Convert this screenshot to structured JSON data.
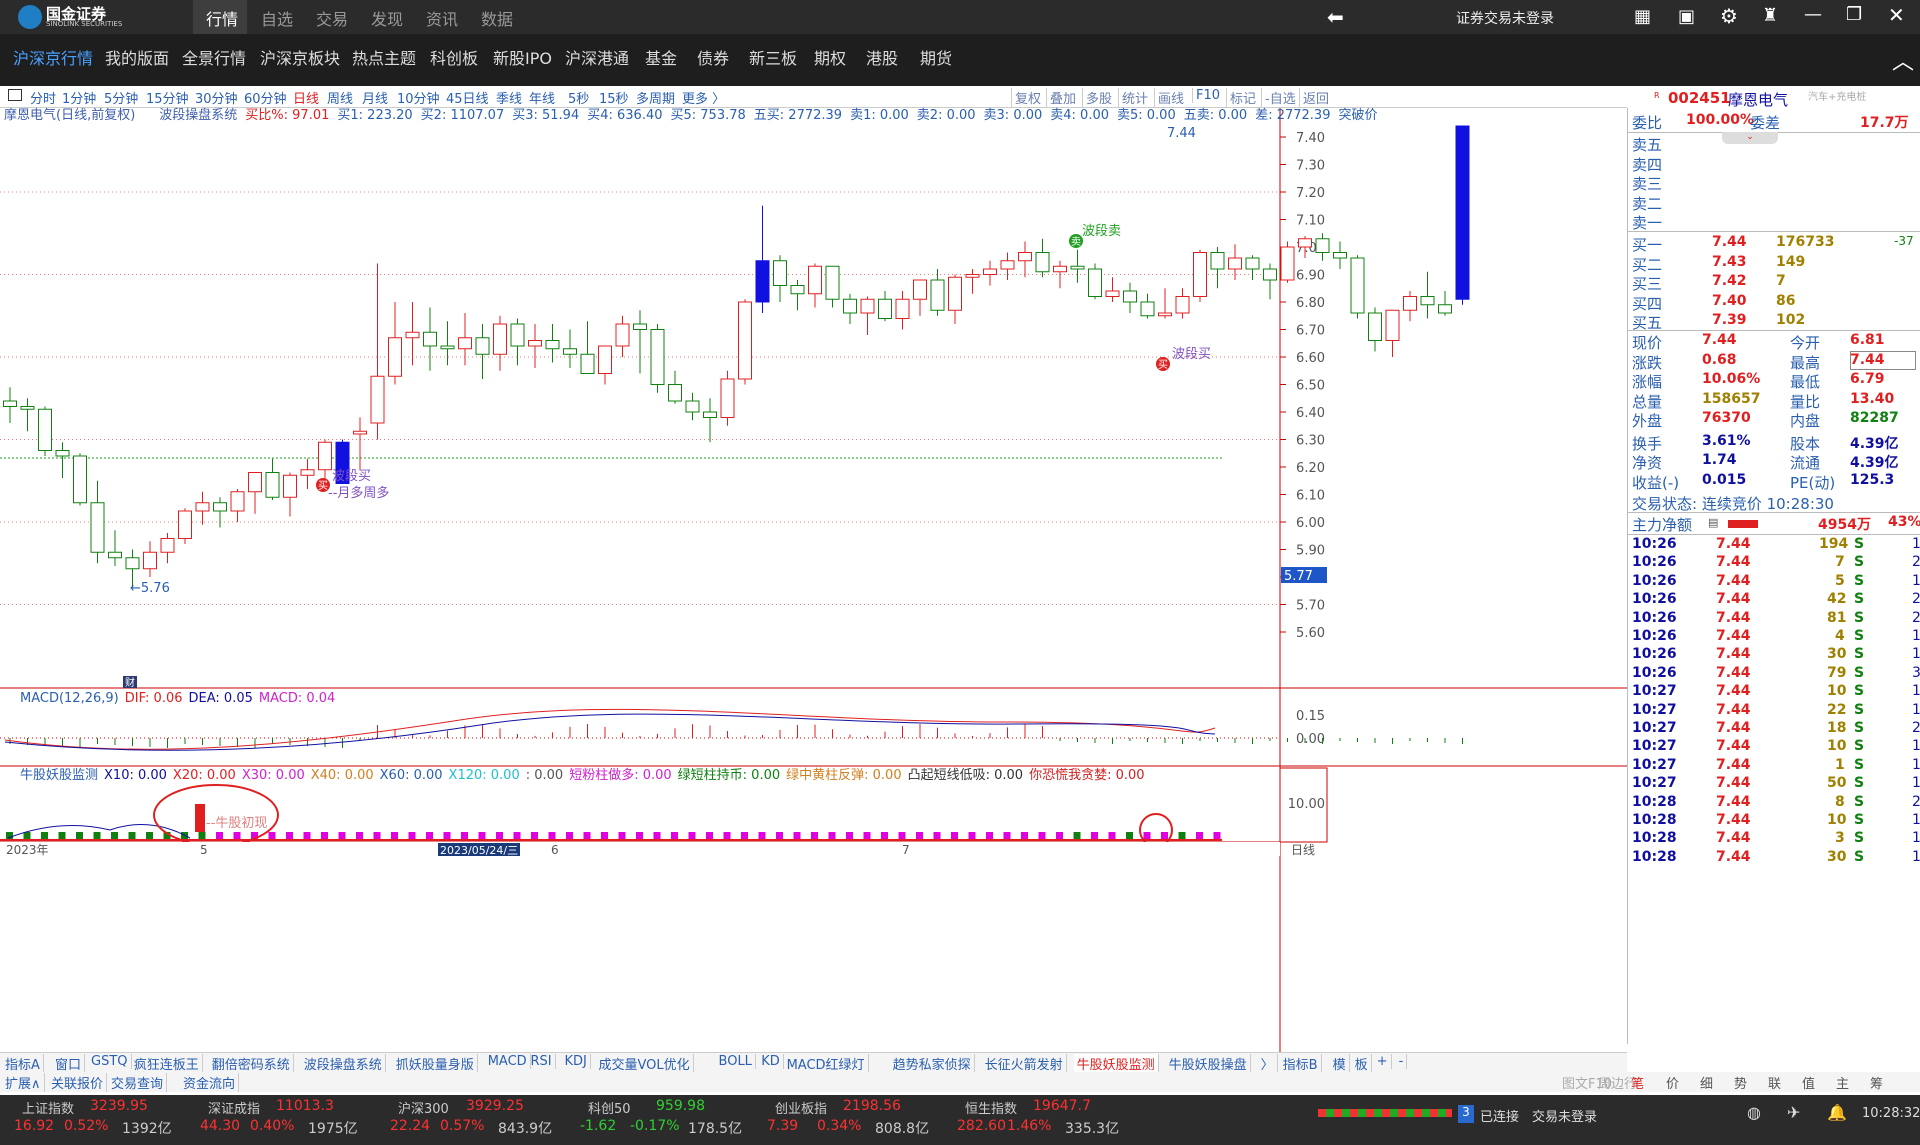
{
  "app": {
    "logo_text": "国金证券",
    "logo_sub": "SINOLINK SECURITIES",
    "login_status": "证券交易未登录"
  },
  "top_tabs": [
    "行情",
    "自选",
    "交易",
    "发现",
    "资讯",
    "数据"
  ],
  "nav_tabs": [
    "沪深京行情",
    "我的版面",
    "全景行情",
    "沪深京板块",
    "热点主题",
    "科创板",
    "新股IPO",
    "沪深港通",
    "基金",
    "债券",
    "新三板",
    "期权",
    "港股",
    "期货"
  ],
  "periods": [
    "分时",
    "1分钟",
    "5分钟",
    "15分钟",
    "30分钟",
    "60分钟",
    "日线",
    "周线",
    "月线",
    "10分钟",
    "45日线",
    "季线",
    "年线",
    "5秒",
    "15秒",
    "多周期",
    "更多 〉"
  ],
  "chart_tools": [
    "复权",
    "叠加",
    "多股",
    "统计",
    "画线",
    "F10",
    "标记",
    "-自选",
    "返回"
  ],
  "info_line": {
    "stock": "摩恩电气(日线,前复权)",
    "system": "波段操盘系统",
    "items": [
      "买比%: 97.01",
      "买1: 223.20",
      "买2: 1107.07",
      "买3: 51.94",
      "买4: 636.40",
      "买5: 753.78",
      "五买: 2772.39",
      "卖1: 0.00",
      "卖2: 0.00",
      "卖3: 0.00",
      "卖4: 0.00",
      "卖5: 0.00",
      "五卖: 0.00",
      "差: 2772.39",
      "突破价"
    ]
  },
  "price_labels": [
    "7.40",
    "7.30",
    "7.20",
    "7.10",
    "7.00",
    "6.90",
    "6.80",
    "6.70",
    "6.60",
    "6.50",
    "6.40",
    "6.30",
    "6.20",
    "6.10",
    "6.00",
    "5.90",
    "5.80",
    "5.70",
    "5.60"
  ],
  "current_tag": "5.77",
  "annotations": {
    "low": "←5.76",
    "high": "7.44",
    "buy1": "波段买",
    "buy1b": "--月多周多",
    "sell": "波段卖",
    "buy2": "波段买",
    "buy_mark": "买",
    "sell_mark": "卖",
    "fin": "财"
  },
  "date_axis": {
    "year": "2023年",
    "m5": "5",
    "m6": "6",
    "m7": "7",
    "cursor": "2023/05/24/三",
    "period": "日线"
  },
  "macd": {
    "title": "MACD(12,26,9)",
    "dif": "DIF: 0.06",
    "dea": "DEA: 0.05",
    "macd": "MACD: 0.04",
    "labels": [
      "0.15",
      "0.00"
    ]
  },
  "monitor": {
    "title": "牛股妖股监测",
    "items": [
      "X10: 0.00",
      "X20: 0.00",
      "X30: 0.00",
      "X40: 0.00",
      "X60: 0.00",
      "X120: 0.00",
      ": 0.00",
      "短粉柱做多: 0.00",
      "绿短柱持币: 0.00",
      "绿中黄柱反弹: 0.00",
      "凸起短线低吸: 0.00",
      "你恐慌我贪婪: 0.00"
    ],
    "label": "10.00",
    "callout": "--牛股初现"
  },
  "bottom_tabs": [
    "指标A",
    "窗口",
    "GSTQ",
    "疯狂连板王",
    "翻倍密码系统",
    "波段操盘系统",
    "抓妖股量身版",
    "MACD",
    "RSI",
    "KDJ",
    "成交量VOL优化",
    "BOLL",
    "KD",
    "MACD红绿灯",
    "趋势私家侦探",
    "长征火箭发射",
    "牛股妖股监测",
    "牛股妖股操盘",
    "〉",
    "指标B",
    "模",
    "板",
    "+",
    "-"
  ],
  "bottom_tabs2": [
    "扩展∧",
    "关联报价",
    "交易查询",
    "资金流向"
  ],
  "right_bottom_tabs": [
    "图文F10",
    "周边行",
    "笔",
    "价",
    "细",
    "势",
    "联",
    "值",
    "主",
    "筹"
  ],
  "quote": {
    "code": "002451",
    "name": "摩恩电气",
    "tag": "汽车+充电桩",
    "weibi": "委比",
    "weibi_val": "100.00%",
    "weicha": "委差",
    "weicha_val": "17.7万",
    "sells": [
      "卖五",
      "卖四",
      "卖三",
      "卖二",
      "卖一"
    ],
    "buys": [
      [
        "买一",
        "7.44",
        "176733",
        "-37"
      ],
      [
        "买二",
        "7.43",
        "149",
        ""
      ],
      [
        "买三",
        "7.42",
        "7",
        ""
      ],
      [
        "买四",
        "7.40",
        "86",
        ""
      ],
      [
        "买五",
        "7.39",
        "102",
        ""
      ]
    ],
    "stats": [
      [
        "现价",
        "7.44",
        "今开",
        "6.81"
      ],
      [
        "涨跌",
        "0.68",
        "最高",
        "7.44"
      ],
      [
        "涨幅",
        "10.06%",
        "最低",
        "6.79"
      ],
      [
        "总量",
        "158657",
        "量比",
        "13.40"
      ],
      [
        "外盘",
        "76370",
        "内盘",
        "82287"
      ],
      [
        "换手",
        "3.61%",
        "股本",
        "4.39亿"
      ],
      [
        "净资",
        "1.74",
        "流通",
        "4.39亿"
      ],
      [
        "收益(-)",
        "0.015",
        "PE(动)",
        "125.3"
      ]
    ],
    "trade_status": "交易状态: 连续竞价 10:28:30",
    "main_flow": "主力净额",
    "main_flow_val": "4954万",
    "main_flow_pct": "43%",
    "ticks": [
      [
        "10:26",
        "7.44",
        "194",
        "S",
        "1"
      ],
      [
        "10:26",
        "7.44",
        "7",
        "S",
        "2"
      ],
      [
        "10:26",
        "7.44",
        "5",
        "S",
        "1"
      ],
      [
        "10:26",
        "7.44",
        "42",
        "S",
        "2"
      ],
      [
        "10:26",
        "7.44",
        "81",
        "S",
        "2"
      ],
      [
        "10:26",
        "7.44",
        "4",
        "S",
        "1"
      ],
      [
        "10:26",
        "7.44",
        "30",
        "S",
        "1"
      ],
      [
        "10:26",
        "7.44",
        "79",
        "S",
        "3"
      ],
      [
        "10:27",
        "7.44",
        "10",
        "S",
        "1"
      ],
      [
        "10:27",
        "7.44",
        "22",
        "S",
        "1"
      ],
      [
        "10:27",
        "7.44",
        "18",
        "S",
        "2"
      ],
      [
        "10:27",
        "7.44",
        "10",
        "S",
        "1"
      ],
      [
        "10:27",
        "7.44",
        "1",
        "S",
        "1"
      ],
      [
        "10:27",
        "7.44",
        "50",
        "S",
        "1"
      ],
      [
        "10:28",
        "7.44",
        "8",
        "S",
        "2"
      ],
      [
        "10:28",
        "7.44",
        "10",
        "S",
        "1"
      ],
      [
        "10:28",
        "7.44",
        "3",
        "S",
        "1"
      ],
      [
        "10:28",
        "7.44",
        "30",
        "S",
        "1"
      ]
    ]
  },
  "indices": [
    {
      "name": "上证指数",
      "val": "3239.95",
      "chg": "16.92",
      "pct": "0.52%",
      "amt": "1392亿"
    },
    {
      "name": "深证成指",
      "val": "11013.3",
      "chg": "44.30",
      "pct": "0.40%",
      "amt": "1975亿"
    },
    {
      "name": "沪深300",
      "val": "3929.25",
      "chg": "22.24",
      "pct": "0.57%",
      "amt": "843.9亿"
    },
    {
      "name": "科创50",
      "val": "959.98",
      "chg": "-1.62",
      "pct": "-0.17%",
      "amt": "178.5亿"
    },
    {
      "name": "创业板指",
      "val": "2198.56",
      "chg": "7.39",
      "pct": "0.34%",
      "amt": "808.8亿"
    },
    {
      "name": "恒生指数",
      "val": "19647.7",
      "chg": "282.60",
      "pct": "1.46%",
      "amt": "335.3亿"
    }
  ],
  "status": {
    "conn_num": "3",
    "conn": "已连接",
    "trade": "交易未登录",
    "time": "10:28:32"
  },
  "chart_data": {
    "type": "candlestick",
    "ylim": [
      5.55,
      7.45
    ],
    "candles": [
      [
        6.44,
        6.49,
        6.36,
        6.42
      ],
      [
        6.42,
        6.45,
        6.33,
        6.41
      ],
      [
        6.41,
        6.42,
        6.24,
        6.26
      ],
      [
        6.26,
        6.29,
        6.16,
        6.24
      ],
      [
        6.24,
        6.25,
        6.06,
        6.07
      ],
      [
        6.07,
        6.15,
        5.85,
        5.89
      ],
      [
        5.89,
        5.97,
        5.84,
        5.87
      ],
      [
        5.87,
        5.9,
        5.76,
        5.83
      ],
      [
        5.83,
        5.93,
        5.8,
        5.89
      ],
      [
        5.89,
        5.96,
        5.85,
        5.94
      ],
      [
        5.94,
        6.05,
        5.92,
        6.04
      ],
      [
        6.04,
        6.11,
        5.99,
        6.07
      ],
      [
        6.07,
        6.09,
        5.98,
        6.04
      ],
      [
        6.04,
        6.12,
        6.0,
        6.11
      ],
      [
        6.11,
        6.18,
        6.03,
        6.18
      ],
      [
        6.18,
        6.23,
        6.08,
        6.09
      ],
      [
        6.09,
        6.18,
        6.02,
        6.17
      ],
      [
        6.17,
        6.23,
        6.12,
        6.19
      ],
      [
        6.19,
        6.3,
        6.14,
        6.29
      ],
      [
        6.29,
        6.3,
        6.15,
        6.14
      ],
      [
        6.32,
        6.38,
        6.19,
        6.33
      ],
      [
        6.36,
        6.94,
        6.3,
        6.53
      ],
      [
        6.53,
        6.8,
        6.5,
        6.67
      ],
      [
        6.67,
        6.8,
        6.57,
        6.69
      ],
      [
        6.69,
        6.78,
        6.55,
        6.64
      ],
      [
        6.64,
        6.73,
        6.57,
        6.63
      ],
      [
        6.63,
        6.76,
        6.57,
        6.67
      ],
      [
        6.67,
        6.72,
        6.52,
        6.61
      ],
      [
        6.61,
        6.75,
        6.55,
        6.72
      ],
      [
        6.72,
        6.74,
        6.57,
        6.64
      ],
      [
        6.64,
        6.72,
        6.56,
        6.66
      ],
      [
        6.66,
        6.72,
        6.58,
        6.63
      ],
      [
        6.63,
        6.7,
        6.56,
        6.61
      ],
      [
        6.61,
        6.73,
        6.55,
        6.54
      ],
      [
        6.54,
        6.62,
        6.5,
        6.64
      ],
      [
        6.64,
        6.75,
        6.6,
        6.72
      ],
      [
        6.72,
        6.77,
        6.54,
        6.7
      ],
      [
        6.7,
        6.72,
        6.47,
        6.5
      ],
      [
        6.5,
        6.55,
        6.43,
        6.44
      ],
      [
        6.44,
        6.47,
        6.37,
        6.4
      ],
      [
        6.4,
        6.45,
        6.29,
        6.38
      ],
      [
        6.38,
        6.55,
        6.35,
        6.52
      ],
      [
        6.52,
        6.81,
        6.5,
        6.8
      ],
      [
        6.8,
        7.15,
        6.76,
        6.95
      ],
      [
        6.95,
        6.97,
        6.8,
        6.86
      ],
      [
        6.86,
        6.88,
        6.77,
        6.83
      ],
      [
        6.83,
        6.94,
        6.78,
        6.93
      ],
      [
        6.93,
        6.93,
        6.78,
        6.81
      ],
      [
        6.81,
        6.83,
        6.72,
        6.76
      ],
      [
        6.76,
        6.82,
        6.68,
        6.81
      ],
      [
        6.81,
        6.84,
        6.73,
        6.74
      ],
      [
        6.74,
        6.84,
        6.7,
        6.81
      ],
      [
        6.81,
        6.86,
        6.75,
        6.88
      ],
      [
        6.88,
        6.92,
        6.75,
        6.77
      ],
      [
        6.77,
        6.9,
        6.72,
        6.89
      ],
      [
        6.89,
        6.92,
        6.83,
        6.9
      ],
      [
        6.9,
        6.95,
        6.86,
        6.92
      ],
      [
        6.92,
        6.98,
        6.88,
        6.95
      ],
      [
        6.95,
        7.02,
        6.89,
        6.98
      ],
      [
        6.98,
        7.03,
        6.89,
        6.91
      ],
      [
        6.91,
        6.95,
        6.85,
        6.93
      ],
      [
        6.93,
        6.99,
        6.87,
        6.92
      ],
      [
        6.92,
        6.94,
        6.81,
        6.82
      ],
      [
        6.82,
        6.89,
        6.8,
        6.84
      ],
      [
        6.84,
        6.87,
        6.76,
        6.8
      ],
      [
        6.8,
        6.83,
        6.74,
        6.75
      ],
      [
        6.75,
        6.85,
        6.74,
        6.76
      ],
      [
        6.76,
        6.85,
        6.74,
        6.82
      ],
      [
        6.82,
        6.99,
        6.8,
        6.98
      ],
      [
        6.98,
        7.0,
        6.85,
        6.92
      ],
      [
        6.92,
        7.01,
        6.88,
        6.96
      ],
      [
        6.96,
        6.97,
        6.88,
        6.92
      ],
      [
        6.92,
        6.94,
        6.81,
        6.88
      ],
      [
        6.88,
        7.02,
        6.87,
        7.0
      ],
      [
        7.0,
        7.04,
        6.96,
        7.03
      ],
      [
        7.03,
        7.05,
        6.95,
        6.98
      ],
      [
        6.98,
        7.02,
        6.92,
        6.96
      ],
      [
        6.96,
        6.97,
        6.74,
        6.76
      ],
      [
        6.76,
        6.78,
        6.62,
        6.66
      ],
      [
        6.66,
        6.77,
        6.6,
        6.77
      ],
      [
        6.77,
        6.84,
        6.73,
        6.82
      ],
      [
        6.82,
        6.91,
        6.74,
        6.79
      ],
      [
        6.79,
        6.84,
        6.75,
        6.76
      ],
      [
        6.81,
        7.44,
        6.79,
        7.44
      ]
    ],
    "series": [
      {
        "name": "波段",
        "blue_candles": [
          19,
          43,
          83
        ]
      }
    ]
  }
}
